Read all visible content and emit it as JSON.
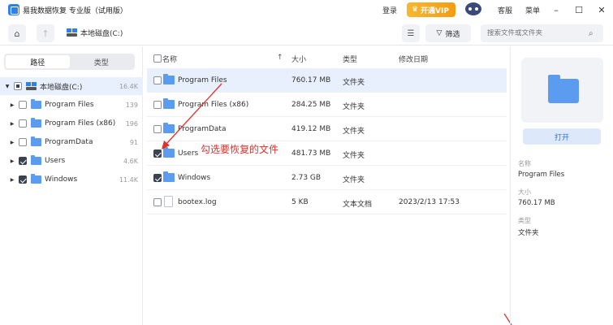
{
  "app": {
    "title": "易我数据恢复 专业版（试用版）",
    "login": "登录",
    "vip": "开通VIP",
    "support": "客服",
    "menu": "菜单"
  },
  "toolbar": {
    "path": "本地磁盘(C:)",
    "filter": "筛选",
    "search_placeholder": "搜索文件或文件夹"
  },
  "left": {
    "tabs": [
      "路径",
      "类型"
    ],
    "tree": [
      {
        "label": "本地磁盘(C:)",
        "count": "16.4K",
        "state": "partial"
      },
      {
        "label": "Program Files",
        "count": "139",
        "state": "unchecked"
      },
      {
        "label": "Program Files (x86)",
        "count": "196",
        "state": "unchecked"
      },
      {
        "label": "ProgramData",
        "count": "91",
        "state": "unchecked"
      },
      {
        "label": "Users",
        "count": "4.6K",
        "state": "checked"
      },
      {
        "label": "Windows",
        "count": "11.4K",
        "state": "checked"
      }
    ]
  },
  "list": {
    "headers": {
      "name": "名称",
      "size": "大小",
      "type": "类型",
      "modified": "修改日期"
    },
    "rows": [
      {
        "name": "Program Files",
        "size": "760.17 MB",
        "type": "文件夹",
        "date": "",
        "checked": false
      },
      {
        "name": "Program Files (x86)",
        "size": "284.25 MB",
        "type": "文件夹",
        "date": "",
        "checked": false
      },
      {
        "name": "ProgramData",
        "size": "419.12 MB",
        "type": "文件夹",
        "date": "",
        "checked": false
      },
      {
        "name": "Users",
        "size": "481.73 MB",
        "type": "文件夹",
        "date": "",
        "checked": true
      },
      {
        "name": "Windows",
        "size": "2.73 GB",
        "type": "文件夹",
        "date": "",
        "checked": true
      },
      {
        "name": "bootex.log",
        "size": "5 KB",
        "type": "文本文档",
        "date": "2023/2/13 17:53",
        "checked": false
      }
    ]
  },
  "annotation": "勾选要恢复的文件",
  "details": {
    "open": "打开",
    "name_label": "名称",
    "name_value": "Program Files",
    "size_label": "大小",
    "size_value": "760.17 MB",
    "type_label": "类型",
    "type_value": "文件夹"
  },
  "colors": {
    "accent": "#2f80ed",
    "vip": "#f39c12",
    "annotation": "#e0302b"
  }
}
